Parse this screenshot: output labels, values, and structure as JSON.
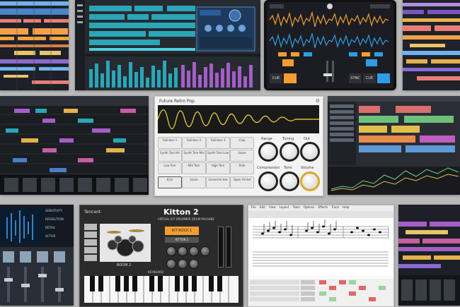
{
  "groove": {
    "title": "Future Retro Pop",
    "pads": [
      [
        "Fullclass 1",
        "Fullclass 2",
        "Fullclass 3",
        "Clap"
      ],
      [
        "Synth Tom Hit",
        "Synth Tom Mid",
        "Synth Tom Low",
        "Snare"
      ],
      [
        "Low Tom",
        "Mid Tom",
        "High Tom",
        "Ride"
      ],
      [
        "Kick",
        "Snare",
        "Closed Hi Hat",
        "Open Hi Hat"
      ]
    ],
    "knobs": [
      "Range",
      "Tuning",
      "Out",
      "Compression",
      "Tone",
      "Volume"
    ]
  },
  "kitton": {
    "brand": "Tencent",
    "title": "Kitton 2",
    "subtitle": "VIRTUAL KIT DRUMMER DRUM MACHINE",
    "preset": "KIT ROCK 1",
    "name_plate": "KITTON 2",
    "drum_label": "BOOM 2",
    "bottom_label": "KEYBOARD"
  },
  "scoreapp": {
    "menu": [
      "File",
      "Edit",
      "View",
      "Layout",
      "Tools",
      "Options",
      "Effects",
      "Track",
      "Help"
    ]
  },
  "dj": {
    "track_title": "Alon Grace feat Leads",
    "track_time": "2:14",
    "buttons": [
      "CUE",
      "SYNC",
      "CUE"
    ]
  },
  "mixer": {
    "labels": [
      "SENSITIVITY",
      "RESOLUTION",
      "DETAIL",
      "ACTIVE"
    ]
  },
  "colors": {
    "daw_bg": "#1f2329",
    "accent_teal": "#2aa6b8",
    "accent_orange": "#f39c33",
    "accent_purple": "#a35ec7",
    "accent_gold": "#d8a92c"
  }
}
